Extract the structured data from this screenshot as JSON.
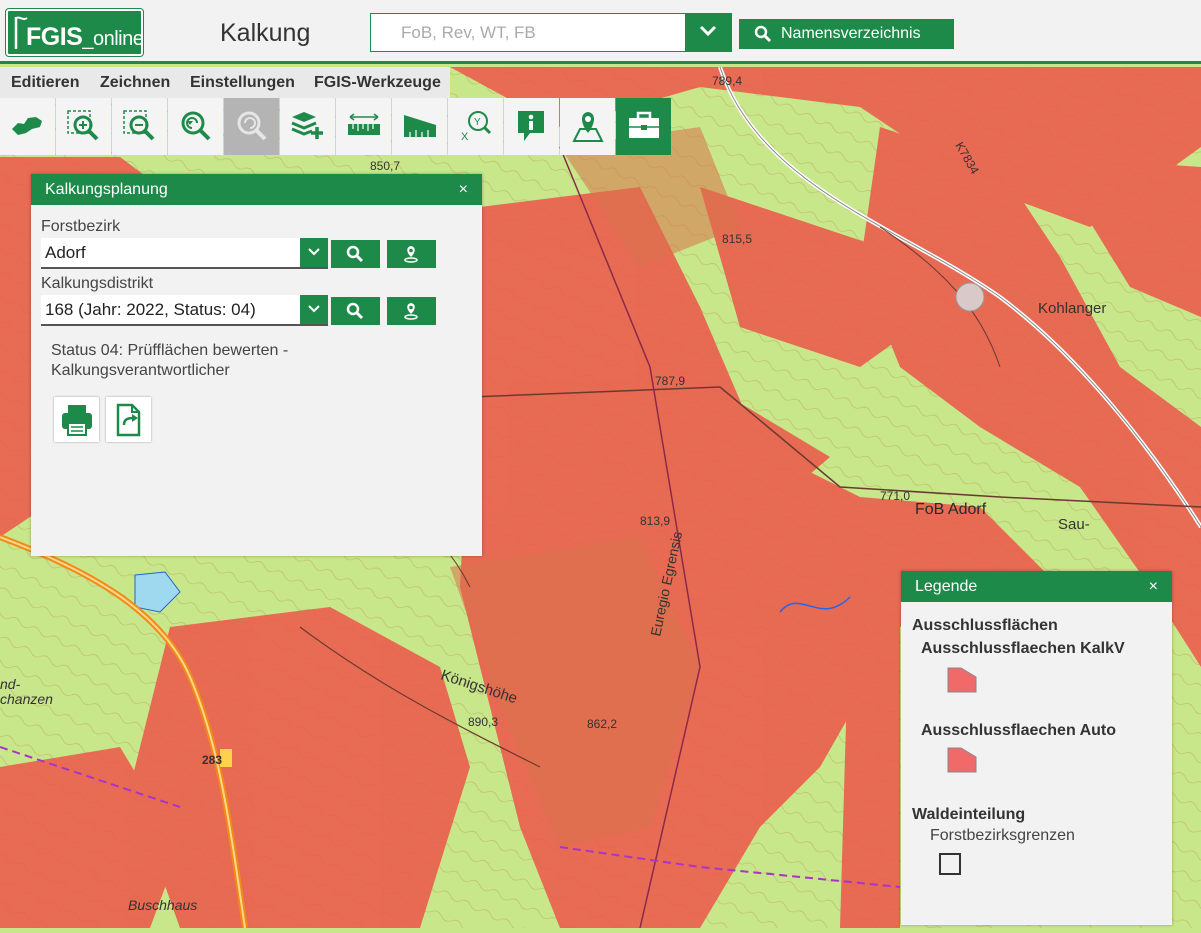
{
  "header": {
    "logo_main": "FGIS",
    "logo_sub": "_online",
    "title": "Kalkung",
    "search_placeholder": "FoB, Rev, WT, FB",
    "names_button": "Namensverzeichnis"
  },
  "menu": [
    "Editieren",
    "Zeichnen",
    "Einstellungen",
    "FGIS-Werkzeuge"
  ],
  "toolbar": [
    {
      "icon": "saxony-map-icon"
    },
    {
      "icon": "zoom-in-rect-icon"
    },
    {
      "icon": "zoom-out-rect-icon"
    },
    {
      "icon": "zoom-previous-icon"
    },
    {
      "icon": "zoom-next-icon",
      "state": "disabled"
    },
    {
      "icon": "add-layers-icon"
    },
    {
      "icon": "measure-distance-icon"
    },
    {
      "icon": "measure-area-icon"
    },
    {
      "icon": "xy-coordinate-icon"
    },
    {
      "icon": "info-icon"
    },
    {
      "icon": "map-location-icon"
    },
    {
      "icon": "toolbox-icon",
      "state": "active"
    }
  ],
  "map_labels": {
    "l1": "789,4",
    "l2": "850,7",
    "l3": "815,5",
    "l4": "K7834",
    "l5": "Kohlanger",
    "l6": "787,9",
    "l7": "771,0",
    "l8": "FoB Adorf",
    "l9": "Sau-",
    "l10": "813,9",
    "l11": "Euregio Egrensis",
    "l12": "Königshöhe",
    "l13": "890,3",
    "l14": "862,2",
    "l15": "Buschhaus",
    "l16": "283",
    "l17": "nd-",
    "l18": "chanzen"
  },
  "kalkungsplanung": {
    "title": "Kalkungsplanung",
    "close": "×",
    "forstbezirk_label": "Forstbezirk",
    "forstbezirk_value": "Adorf",
    "distrikt_label": "Kalkungsdistrikt",
    "distrikt_value": "168 (Jahr: 2022, Status: 04)",
    "status_text": "Status 04: Prüfflächen bewerten - Kalkungsverantwortlicher"
  },
  "legend": {
    "title": "Legende",
    "close": "×",
    "group1": "Ausschlussflächen",
    "item1": "Ausschlussflaechen KalkV",
    "item2": "Ausschlussflaechen Auto",
    "group2": "Waldeinteilung",
    "item3": "Forstbezirksgrenzen"
  },
  "colors": {
    "brand": "#1e8a4a",
    "exclusion": "#f06a5a",
    "forest": "#c8e68a"
  }
}
